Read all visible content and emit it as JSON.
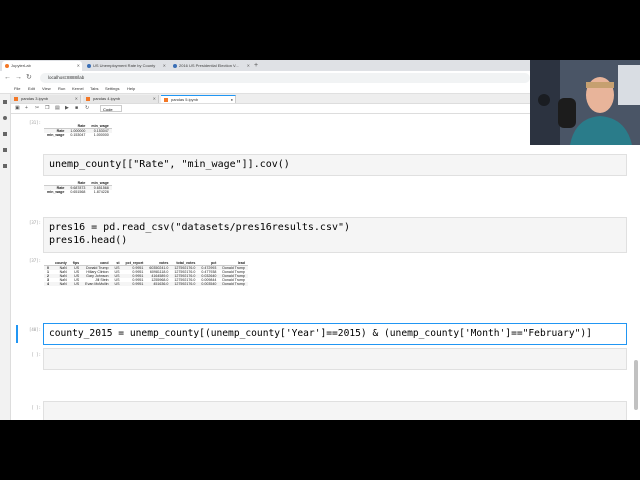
{
  "browser": {
    "tabs": [
      {
        "label": "JupyterLab"
      },
      {
        "label": "US Unemployment Rate by County"
      },
      {
        "label": "2016 US Presidential Election V..."
      }
    ],
    "address": "localhost:8888/lab"
  },
  "menus": [
    "File",
    "Edit",
    "View",
    "Run",
    "Kernel",
    "Tabs",
    "Settings",
    "Help"
  ],
  "notebook_tabs": [
    "pandas 3.ipynb",
    "pandas 4.ipynb",
    "pandas 5.ipynb"
  ],
  "toolbar": {
    "cell_type": "Code"
  },
  "cells": {
    "out1": {
      "prompt": "[31]:",
      "headers": [
        "",
        "Rate",
        "min_wage"
      ],
      "rows": [
        [
          "Rate",
          "1.000000",
          "0.153047"
        ],
        [
          "min_wage",
          "0.153047",
          "1.000000"
        ]
      ]
    },
    "code2": {
      "code": "unemp_county[[\"Rate\", \"min_wage\"]].cov()"
    },
    "out2": {
      "headers": [
        "",
        "Rate",
        "min_wage"
      ],
      "rows": [
        [
          "Rate",
          "9.687873",
          "0.651568"
        ],
        [
          "min_wage",
          "0.651568",
          "1.874228"
        ]
      ]
    },
    "code3": {
      "prompt": "[37]:",
      "line1": "pres16 = pd.read_csv(\"datasets/pres16results.csv\")",
      "line2": "pres16.head()"
    },
    "out3": {
      "prompt": "[37]:",
      "headers": [
        "",
        "county",
        "fips",
        "cand",
        "st",
        "pct_report",
        "votes",
        "total_votes",
        "pct",
        "lead"
      ],
      "rows": [
        [
          "0",
          "NaN",
          "US",
          "Donald Trump",
          "US",
          "0.9951",
          "60350241.0",
          "127592176.0",
          "0.472993",
          "Donald Trump"
        ],
        [
          "1",
          "NaN",
          "US",
          "Hillary Clinton",
          "US",
          "0.9951",
          "60981118.0",
          "127592176.0",
          "0.477938",
          "Donald Trump"
        ],
        [
          "2",
          "NaN",
          "US",
          "Gary Johnson",
          "US",
          "0.9951",
          "4164589.0",
          "127592176.0",
          "0.032640",
          "Donald Trump"
        ],
        [
          "3",
          "NaN",
          "US",
          "Jill Stein",
          "US",
          "0.9951",
          "1255968.0",
          "127592176.0",
          "0.009844",
          "Donald Trump"
        ],
        [
          "4",
          "NaN",
          "US",
          "Evan McMullin",
          "US",
          "0.9951",
          "451636.0",
          "127592176.0",
          "0.003540",
          "Donald Trump"
        ]
      ]
    },
    "code4": {
      "prompt": "[40]:",
      "code": "county_2015 = unemp_county[(unemp_county['Year']==2015) & (unemp_county['Month']==\"February\")]"
    },
    "code5": {
      "prompt": "[ ]:"
    },
    "code6": {
      "prompt": "[ ]:"
    }
  }
}
